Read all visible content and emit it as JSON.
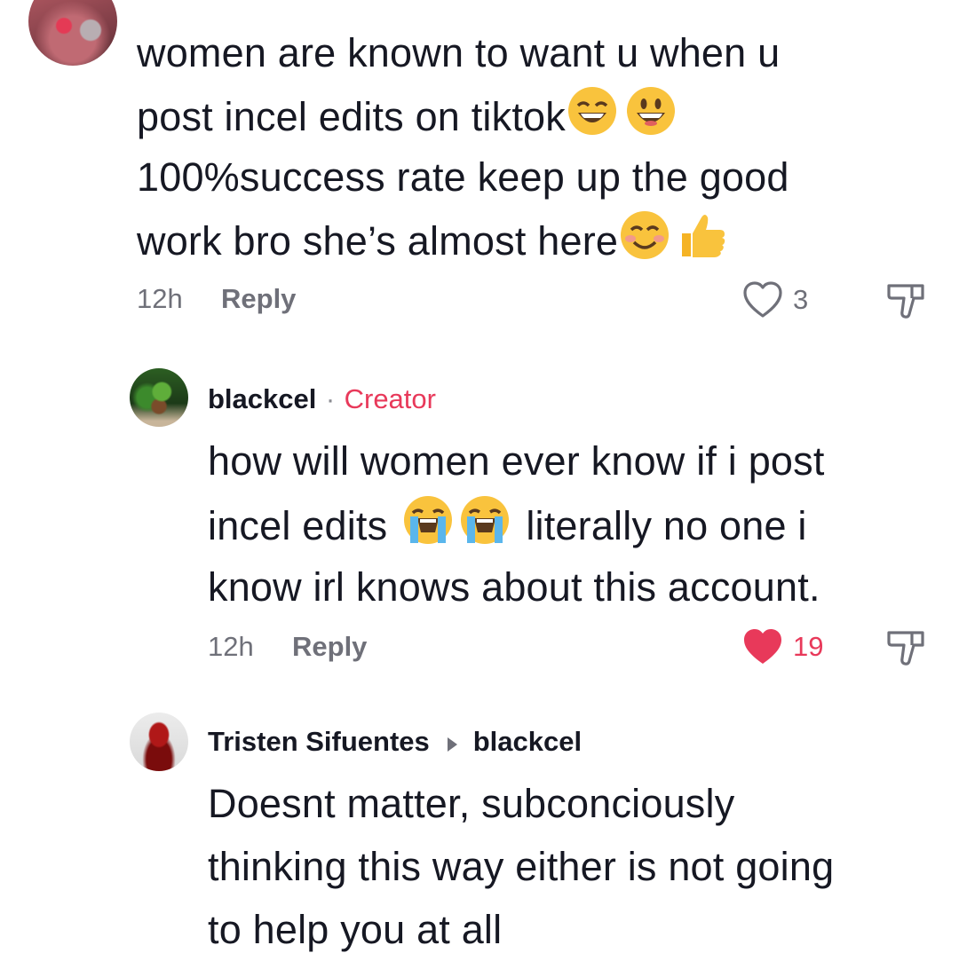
{
  "comments": [
    {
      "text_lines": [
        "women are known to want u when u",
        "post incel edits on tiktok",
        "100%success rate keep up the good",
        "work bro she’s almost here"
      ],
      "time": "12h",
      "reply_label": "Reply",
      "likes": "3",
      "liked": false
    },
    {
      "username": "blackcel",
      "separator": "·",
      "badge": "Creator",
      "text_lines": [
        "how will women ever know if i post",
        "incel edits",
        "literally no one i",
        "know irl knows about this account."
      ],
      "time": "12h",
      "reply_label": "Reply",
      "likes": "19",
      "liked": true
    },
    {
      "username": "Tristen Sifuentes",
      "reply_to": "blackcel",
      "text_lines": [
        "Doesnt matter, subconciously",
        "thinking this way either is not going",
        "to help you at all"
      ]
    }
  ],
  "colors": {
    "text": "#161823",
    "meta": "#6f7079",
    "accent": "#e8395a"
  }
}
